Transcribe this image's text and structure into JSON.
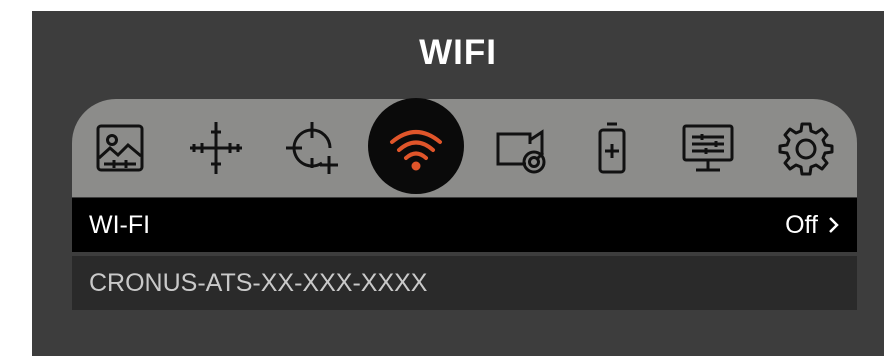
{
  "title": "WIFI",
  "icons": [
    {
      "name": "image-settings-icon",
      "active": false
    },
    {
      "name": "reticle-icon",
      "active": false
    },
    {
      "name": "crosshair-add-icon",
      "active": false
    },
    {
      "name": "wifi-icon",
      "active": true
    },
    {
      "name": "camera-record-icon",
      "active": false
    },
    {
      "name": "battery-icon",
      "active": false
    },
    {
      "name": "display-settings-icon",
      "active": false
    },
    {
      "name": "gear-icon",
      "active": false
    }
  ],
  "colors": {
    "active_icon": "#e0552a",
    "inactive_icon": "#111111"
  },
  "wifi_row": {
    "label": "WI-FI",
    "value": "Off"
  },
  "ssid": "CRONUS-ATS-XX-XXX-XXXX"
}
